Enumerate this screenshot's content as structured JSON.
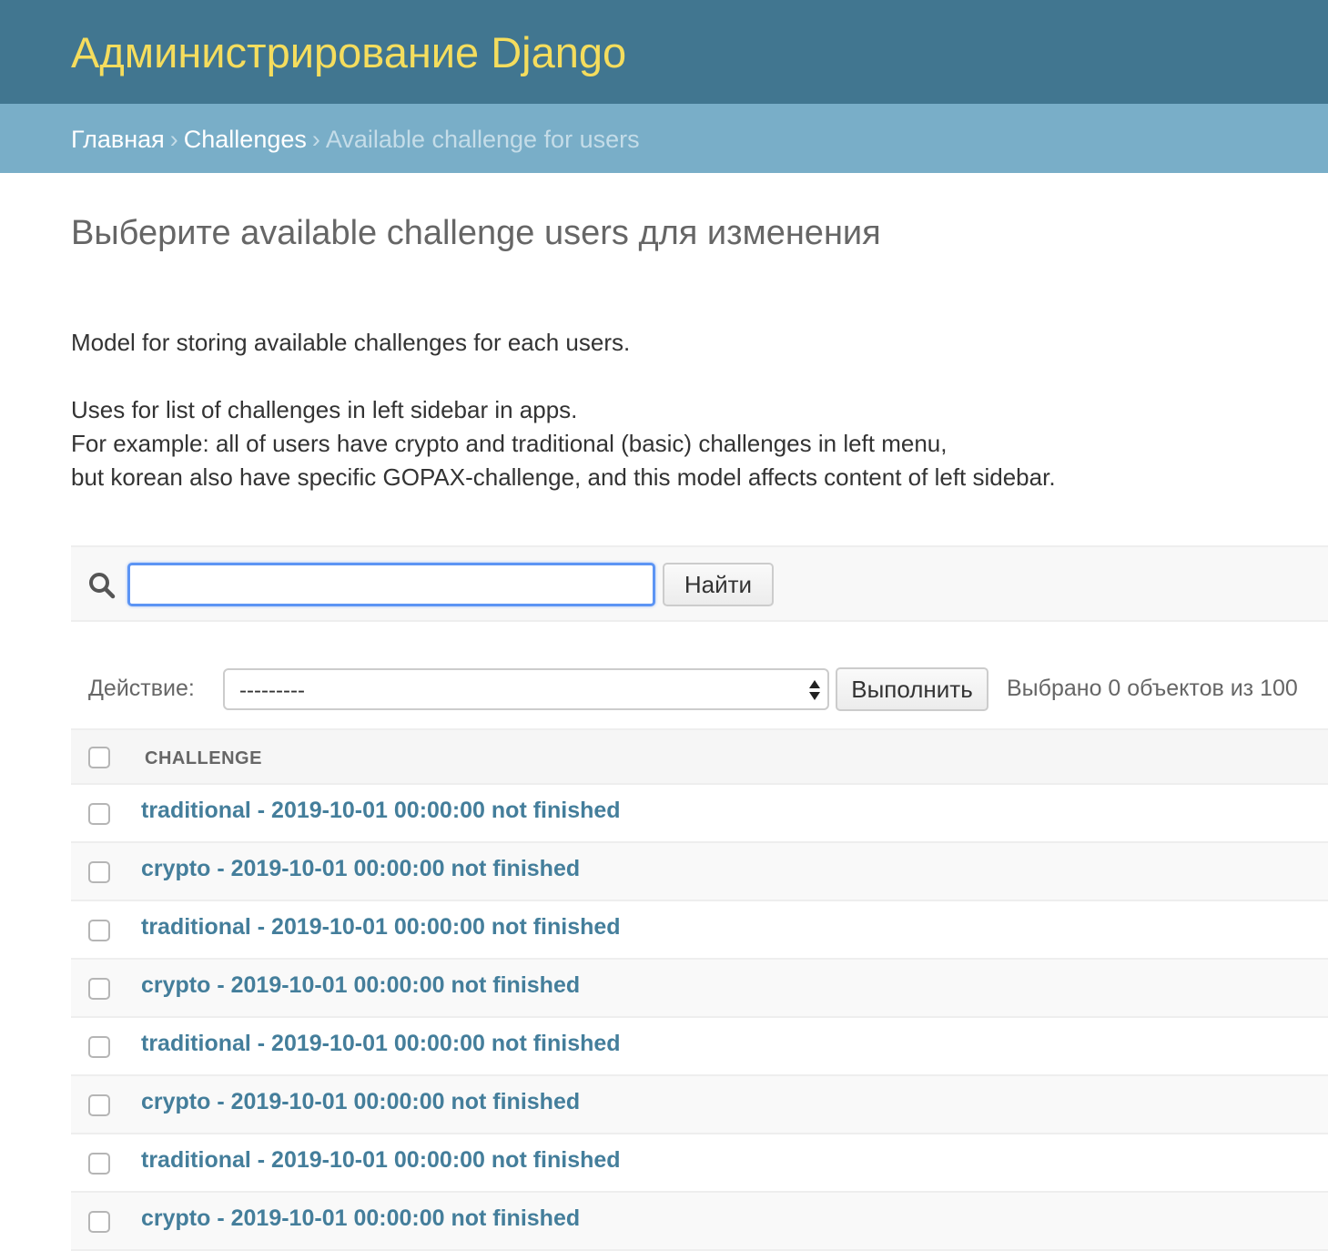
{
  "header": {
    "site_name": "Администрирование Django"
  },
  "breadcrumbs": {
    "home": "Главная",
    "separator": "›",
    "app": "Challenges",
    "current": "Available challenge for users"
  },
  "page": {
    "title": "Выберите available challenge users для изменения",
    "description": [
      "Model for storing available challenges for each users.",
      "Uses for list of challenges in left sidebar in apps.",
      "For example: all of users have crypto and traditional (basic) challenges in left menu,",
      "but korean also have specific GOPAX-challenge, and this model affects content of left sidebar."
    ]
  },
  "search": {
    "icon": "search-icon",
    "value": "",
    "button_label": "Найти"
  },
  "actions": {
    "label": "Действие:",
    "selected": "---------",
    "go_label": "Выполнить",
    "counter": "Выбрано 0 объектов из 100"
  },
  "table": {
    "column_header": "CHALLENGE",
    "rows": [
      "traditional - 2019-10-01 00:00:00 not finished",
      "crypto - 2019-10-01 00:00:00 not finished",
      "traditional - 2019-10-01 00:00:00 not finished",
      "crypto - 2019-10-01 00:00:00 not finished",
      "traditional - 2019-10-01 00:00:00 not finished",
      "crypto - 2019-10-01 00:00:00 not finished",
      "traditional - 2019-10-01 00:00:00 not finished",
      "crypto - 2019-10-01 00:00:00 not finished"
    ]
  },
  "colors": {
    "header_bg": "#417690",
    "breadcrumbs_bg": "#79aec8",
    "site_name": "#f5dd5d",
    "link": "#447e9b"
  }
}
